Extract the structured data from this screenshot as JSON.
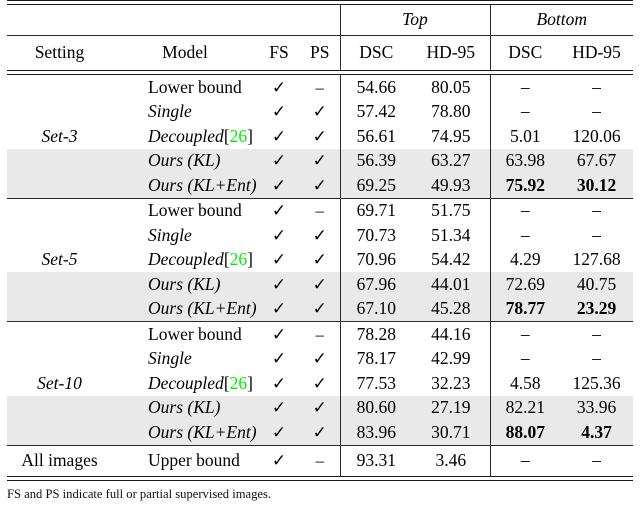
{
  "clipped_caption_text": "",
  "table": {
    "group_headers": {
      "left_blank": "",
      "top": "Top",
      "bottom": "Bottom"
    },
    "columns": [
      "Setting",
      "Model",
      "FS",
      "PS",
      "DSC",
      "HD-95",
      "DSC",
      "HD-95"
    ],
    "symbols": {
      "check": "✓",
      "dash": "–"
    },
    "citation": {
      "open_bracket": "[",
      "number": "26",
      "close_bracket": "]",
      "color": "#00ef00"
    },
    "groups": [
      {
        "setting": "Set-3",
        "rows": [
          {
            "model": "Lower bound",
            "model_style": "roman",
            "cite": false,
            "fs": "✓",
            "ps": "–",
            "top_dsc": "54.66",
            "top_hd95": "80.05",
            "bottom_dsc": "–",
            "bottom_hd95": "–",
            "shaded": false,
            "bold": []
          },
          {
            "model": "Single",
            "model_style": "italic",
            "cite": false,
            "fs": "✓",
            "ps": "✓",
            "top_dsc": "57.42",
            "top_hd95": "78.80",
            "bottom_dsc": "–",
            "bottom_hd95": "–",
            "shaded": false,
            "bold": []
          },
          {
            "model": "Decoupled",
            "model_style": "italic",
            "cite": true,
            "fs": "✓",
            "ps": "✓",
            "top_dsc": "56.61",
            "top_hd95": "74.95",
            "bottom_dsc": "5.01",
            "bottom_hd95": "120.06",
            "shaded": false,
            "bold": []
          },
          {
            "model": "Ours (KL)",
            "model_style": "italic",
            "cite": false,
            "fs": "✓",
            "ps": "✓",
            "top_dsc": "56.39",
            "top_hd95": "63.27",
            "bottom_dsc": "63.98",
            "bottom_hd95": "67.67",
            "shaded": true,
            "bold": []
          },
          {
            "model": "Ours (KL+Ent)",
            "model_style": "italic",
            "cite": false,
            "fs": "✓",
            "ps": "✓",
            "top_dsc": "69.25",
            "top_hd95": "49.93",
            "bottom_dsc": "75.92",
            "bottom_hd95": "30.12",
            "shaded": true,
            "bold": [
              "bottom_dsc",
              "bottom_hd95"
            ]
          }
        ]
      },
      {
        "setting": "Set-5",
        "rows": [
          {
            "model": "Lower bound",
            "model_style": "roman",
            "cite": false,
            "fs": "✓",
            "ps": "–",
            "top_dsc": "69.71",
            "top_hd95": "51.75",
            "bottom_dsc": "–",
            "bottom_hd95": "–",
            "shaded": false,
            "bold": []
          },
          {
            "model": "Single",
            "model_style": "italic",
            "cite": false,
            "fs": "✓",
            "ps": "✓",
            "top_dsc": "70.73",
            "top_hd95": "51.34",
            "bottom_dsc": "–",
            "bottom_hd95": "–",
            "shaded": false,
            "bold": []
          },
          {
            "model": "Decoupled",
            "model_style": "italic",
            "cite": true,
            "fs": "✓",
            "ps": "✓",
            "top_dsc": "70.96",
            "top_hd95": "54.42",
            "bottom_dsc": "4.29",
            "bottom_hd95": "127.68",
            "shaded": false,
            "bold": []
          },
          {
            "model": "Ours (KL)",
            "model_style": "italic",
            "cite": false,
            "fs": "✓",
            "ps": "✓",
            "top_dsc": "67.96",
            "top_hd95": "44.01",
            "bottom_dsc": "72.69",
            "bottom_hd95": "40.75",
            "shaded": true,
            "bold": []
          },
          {
            "model": "Ours (KL+Ent)",
            "model_style": "italic",
            "cite": false,
            "fs": "✓",
            "ps": "✓",
            "top_dsc": "67.10",
            "top_hd95": "45.28",
            "bottom_dsc": "78.77",
            "bottom_hd95": "23.29",
            "shaded": true,
            "bold": [
              "bottom_dsc",
              "bottom_hd95"
            ]
          }
        ]
      },
      {
        "setting": "Set-10",
        "rows": [
          {
            "model": "Lower bound",
            "model_style": "roman",
            "cite": false,
            "fs": "✓",
            "ps": "–",
            "top_dsc": "78.28",
            "top_hd95": "44.16",
            "bottom_dsc": "–",
            "bottom_hd95": "–",
            "shaded": false,
            "bold": []
          },
          {
            "model": "Single",
            "model_style": "italic",
            "cite": false,
            "fs": "✓",
            "ps": "✓",
            "top_dsc": "78.17",
            "top_hd95": "42.99",
            "bottom_dsc": "–",
            "bottom_hd95": "–",
            "shaded": false,
            "bold": []
          },
          {
            "model": "Decoupled",
            "model_style": "italic",
            "cite": true,
            "fs": "✓",
            "ps": "✓",
            "top_dsc": "77.53",
            "top_hd95": "32.23",
            "bottom_dsc": "4.58",
            "bottom_hd95": "125.36",
            "shaded": false,
            "bold": []
          },
          {
            "model": "Ours (KL)",
            "model_style": "italic",
            "cite": false,
            "fs": "✓",
            "ps": "✓",
            "top_dsc": "80.60",
            "top_hd95": "27.19",
            "bottom_dsc": "82.21",
            "bottom_hd95": "33.96",
            "shaded": true,
            "bold": []
          },
          {
            "model": "Ours (KL+Ent)",
            "model_style": "italic",
            "cite": false,
            "fs": "✓",
            "ps": "✓",
            "top_dsc": "83.96",
            "top_hd95": "30.71",
            "bottom_dsc": "88.07",
            "bottom_hd95": "4.37",
            "shaded": true,
            "bold": [
              "bottom_dsc",
              "bottom_hd95"
            ]
          }
        ]
      }
    ],
    "summary_row": {
      "setting": "All images",
      "model": "Upper bound",
      "fs": "✓",
      "ps": "–",
      "top_dsc": "93.31",
      "top_hd95": "3.46",
      "bottom_dsc": "–",
      "bottom_hd95": "–"
    }
  },
  "footnote": "FS and PS indicate full or partial supervised images."
}
